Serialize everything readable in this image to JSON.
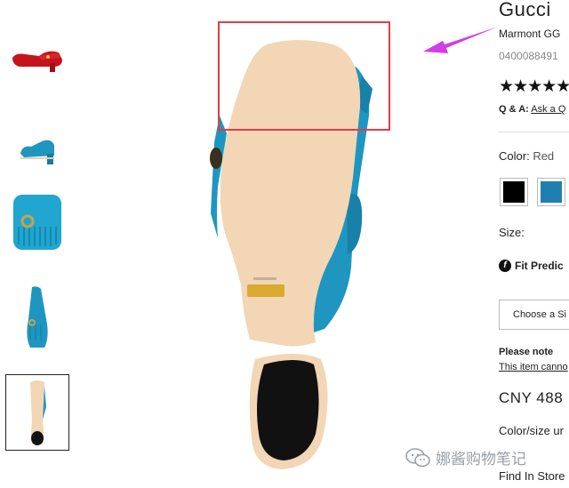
{
  "thumbnails": [
    {
      "name": "thumb-red-pair",
      "selected": false
    },
    {
      "name": "thumb-side",
      "selected": false
    },
    {
      "name": "thumb-front-detail",
      "selected": false
    },
    {
      "name": "thumb-top",
      "selected": false
    },
    {
      "name": "thumb-sole",
      "selected": true
    }
  ],
  "product": {
    "brand": "Gucci",
    "name": "Marmont GG",
    "sku": "0400088491",
    "rating_stars": "★★★★★",
    "qa_label": "Q & A:",
    "qa_link": "Ask a Q",
    "color_label": "Color:",
    "color_value": "Red",
    "size_label": "Size:",
    "fit_label": "Fit Predic",
    "size_select_text": "Choose a Si",
    "note_title": "Please note",
    "note_text": "This item canno",
    "price": "CNY 488",
    "color_size_text": "Color/size ur",
    "in_store": "Find In Store"
  },
  "swatches": [
    {
      "name": "swatch-black",
      "color": "#000000"
    },
    {
      "name": "swatch-blue",
      "color": "#1f7fb0"
    }
  ],
  "colors": {
    "highlight": "#e23c46",
    "arrow": "#d33ce8",
    "suede": "#1e96bf",
    "sole": "#f2d6b5",
    "heel": "#111111"
  },
  "watermark": {
    "text": "娜酱购物笔记",
    "icon": "wechat-icon"
  }
}
